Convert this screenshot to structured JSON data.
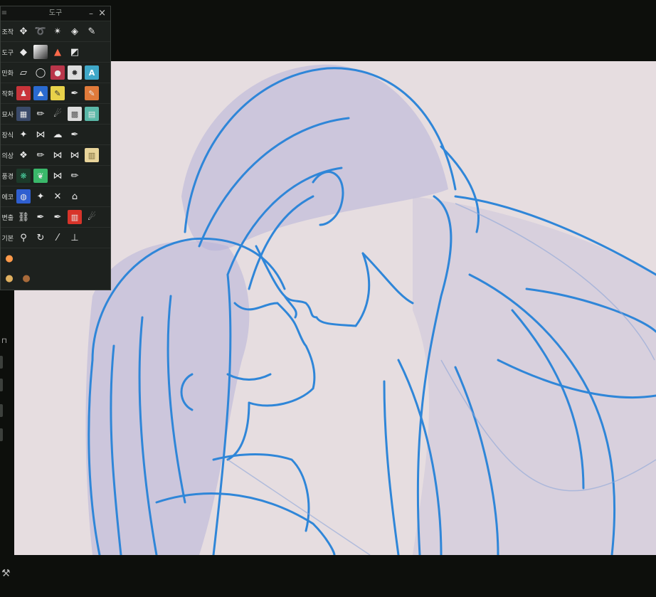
{
  "tool_palette": {
    "title": "도구",
    "close_glyph": "×",
    "rows": [
      {
        "label": "조작",
        "tools": [
          "move-icon",
          "lasso-icon",
          "magic-wand-icon",
          "layer-select-icon",
          "brush-icon"
        ]
      },
      {
        "label": "도구",
        "tools": [
          "eraser-icon",
          "gradient-icon",
          "cake-icon",
          "fill-bucket-icon"
        ]
      },
      {
        "label": "만화",
        "tools": [
          "frame-icon",
          "speech-bubble-icon",
          "sticker-icon",
          "flash-lines-icon",
          "text-icon"
        ]
      },
      {
        "label": "작화",
        "tools": [
          "figure-icon",
          "mountain-icon",
          "marker-icon",
          "pen-icon",
          "colored-pencil-icon"
        ]
      },
      {
        "label": "묘사",
        "tools": [
          "cross-hatch-icon",
          "pencil-icon",
          "smudge-icon",
          "screentone-icon",
          "layout-icon"
        ]
      },
      {
        "label": "장식",
        "tools": [
          "sparkle-icon",
          "ribbon-icon",
          "cloud-icon",
          "pen-icon"
        ]
      },
      {
        "label": "의상",
        "tools": [
          "pattern-icon",
          "pencil-icon",
          "ribbon-icon",
          "ribbon-icon",
          "fabric-icon"
        ]
      },
      {
        "label": "풍경",
        "tools": [
          "tree-icon",
          "leaf-icon",
          "ribbon-icon",
          "pencil-icon"
        ]
      },
      {
        "label": "에코",
        "tools": [
          "planet-icon",
          "sparkle-icon",
          "crossed-swords-icon",
          "house-icon"
        ]
      },
      {
        "label": "변출",
        "tools": [
          "chain-icon",
          "pen-icon",
          "pen-icon",
          "building-icon",
          "smudge-icon"
        ]
      },
      {
        "label": "기본",
        "tools": [
          "zoom-icon",
          "rotate-icon",
          "eyedropper-icon",
          "stamp-icon"
        ]
      }
    ],
    "sub_tools": [
      [
        "peach-icon"
      ],
      [
        "hamster-icon",
        "bear-icon"
      ]
    ]
  },
  "colors": {
    "line": "#2f86d8",
    "shade": "#b4b0d6",
    "canvas": "#e6dde0"
  }
}
